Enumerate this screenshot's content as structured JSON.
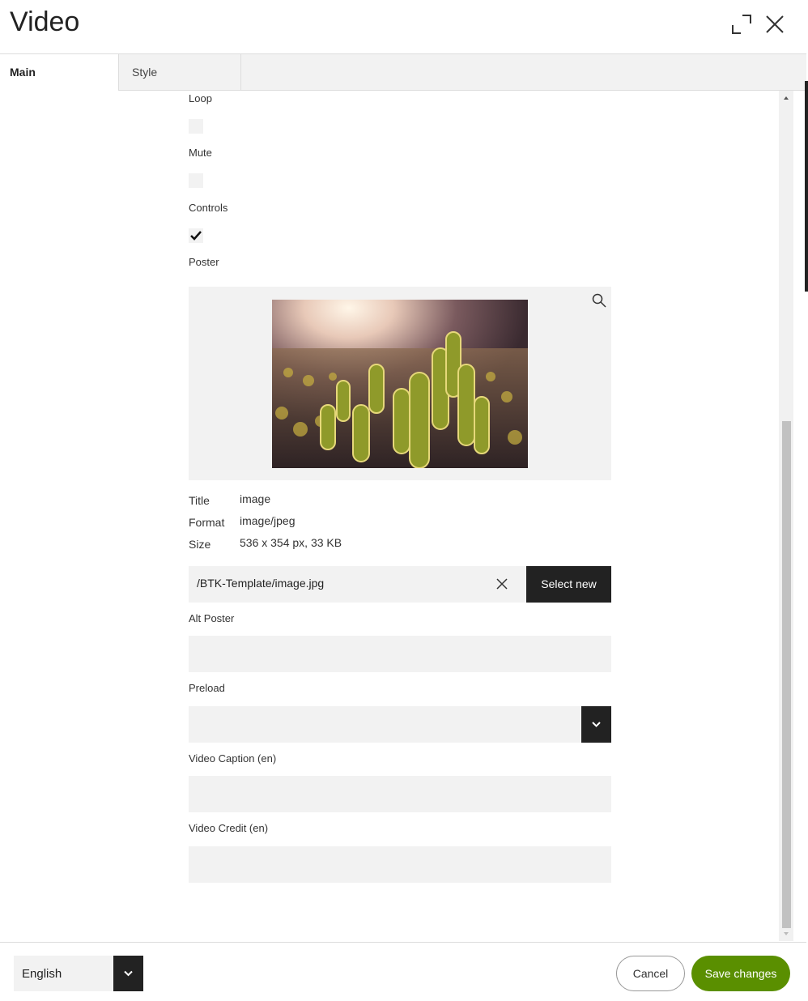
{
  "dialog": {
    "title": "Video",
    "icons": {
      "expand": "expand-icon",
      "close": "close-icon"
    }
  },
  "tabs": [
    {
      "label": "Main",
      "active": true
    },
    {
      "label": "Style",
      "active": false
    }
  ],
  "form": {
    "loop": {
      "label": "Loop",
      "checked": false
    },
    "mute": {
      "label": "Mute",
      "checked": false
    },
    "controls": {
      "label": "Controls",
      "checked": true
    },
    "poster": {
      "label": "Poster",
      "meta": [
        {
          "key": "Title",
          "value": "image"
        },
        {
          "key": "Format",
          "value": "image/jpeg"
        },
        {
          "key": "Size",
          "value": "536 x 354 px, 33 KB"
        }
      ],
      "path": "/BTK-Template/image.jpg",
      "select_new_label": "Select new"
    },
    "alt_poster": {
      "label": "Alt Poster",
      "value": ""
    },
    "preload": {
      "label": "Preload",
      "value": ""
    },
    "video_caption": {
      "label": "Video Caption (en)",
      "value": ""
    },
    "video_credit": {
      "label": "Video Credit (en)",
      "value": ""
    }
  },
  "footer": {
    "language": "English",
    "cancel_label": "Cancel",
    "save_label": "Save changes"
  },
  "colors": {
    "accent": "#5a8f00",
    "dark": "#222222",
    "field_bg": "#f2f2f2"
  }
}
